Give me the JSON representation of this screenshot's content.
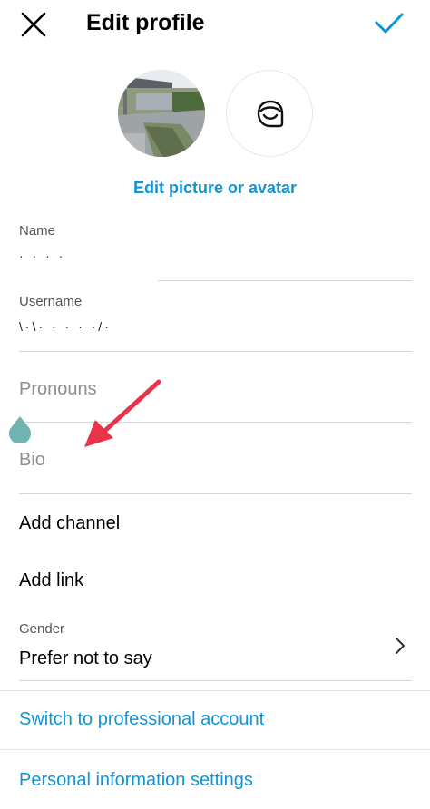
{
  "header": {
    "title": "Edit profile"
  },
  "avatar": {
    "edit_label": "Edit picture or avatar"
  },
  "fields": {
    "name": {
      "label": "Name",
      "value": "· ·   ·  ·"
    },
    "username": {
      "label": "Username",
      "value": "\\·\\·  ·  ·  ·  ·/·"
    },
    "pronouns": {
      "placeholder": "Pronouns"
    },
    "bio": {
      "placeholder": "Bio"
    }
  },
  "actions": {
    "add_channel": "Add channel",
    "add_link": "Add link"
  },
  "gender": {
    "label": "Gender",
    "value": "Prefer not to say"
  },
  "links": {
    "switch_professional": "Switch to professional account",
    "personal_info": "Personal information settings"
  },
  "colors": {
    "accent": "#0f95d6",
    "annotation_arrow": "#e8334a",
    "handle": "#6fb3b3"
  }
}
